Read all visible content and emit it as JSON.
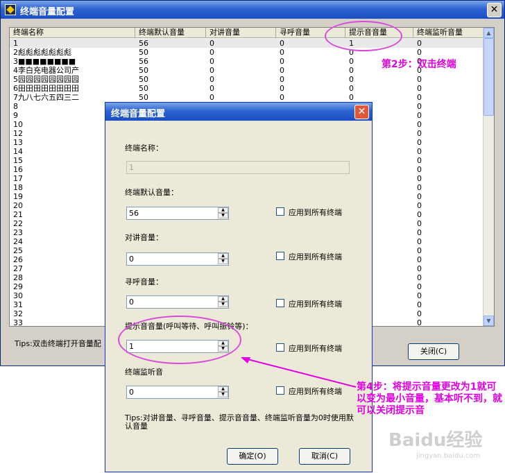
{
  "main": {
    "title": "终端音量配置",
    "columns": [
      "终端名称",
      "终端默认音量",
      "对讲音量",
      "寻呼音量",
      "提示音音量",
      "终端监听音量"
    ],
    "rows": [
      [
        "1",
        "56",
        "0",
        "0",
        "1",
        "0"
      ],
      [
        "2彪彪彪彪彪彪彪",
        "50",
        "0",
        "0",
        "0",
        "0"
      ],
      [
        "3■■■■■■■■",
        "56",
        "0",
        "0",
        "0",
        "0"
      ],
      [
        "4李白充电器公司产",
        "50",
        "0",
        "0",
        "0",
        "0"
      ],
      [
        "5园园园园园园园园",
        "50",
        "0",
        "0",
        "0",
        "0"
      ],
      [
        "6田田田田田田田田",
        "50",
        "0",
        "0",
        "0",
        "0"
      ],
      [
        "7九八七六五四三二",
        "50",
        "0",
        "0",
        "0",
        "0"
      ],
      [
        "8",
        "",
        "",
        "",
        "",
        "0"
      ],
      [
        "9",
        "",
        "",
        "",
        "",
        "0"
      ],
      [
        "10",
        "",
        "",
        "",
        "",
        "0"
      ],
      [
        "12",
        "",
        "",
        "",
        "",
        "0"
      ],
      [
        "13",
        "",
        "",
        "",
        "",
        "0"
      ],
      [
        "14",
        "",
        "",
        "",
        "",
        "0"
      ],
      [
        "15",
        "",
        "",
        "",
        "",
        "0"
      ],
      [
        "16",
        "",
        "",
        "",
        "",
        "0"
      ],
      [
        "17",
        "",
        "",
        "",
        "",
        "0"
      ],
      [
        "18",
        "",
        "",
        "",
        "",
        "0"
      ],
      [
        "19",
        "",
        "",
        "",
        "",
        "0"
      ],
      [
        "20",
        "",
        "",
        "",
        "",
        "0"
      ],
      [
        "21",
        "",
        "",
        "",
        "",
        "0"
      ],
      [
        "22",
        "",
        "",
        "",
        "",
        "0"
      ],
      [
        "23",
        "",
        "",
        "",
        "",
        "0"
      ],
      [
        "24",
        "",
        "",
        "",
        "",
        "0"
      ],
      [
        "25",
        "",
        "",
        "",
        "",
        "0"
      ],
      [
        "26",
        "",
        "",
        "",
        "",
        "0"
      ],
      [
        "27",
        "",
        "",
        "",
        "",
        "0"
      ],
      [
        "28",
        "",
        "",
        "",
        "",
        "0"
      ],
      [
        "29",
        "",
        "",
        "",
        "",
        "0"
      ],
      [
        "30",
        "",
        "",
        "",
        "",
        "0"
      ],
      [
        "31",
        "",
        "",
        "",
        "",
        "0"
      ],
      [
        "32",
        "",
        "",
        "",
        "",
        "0"
      ],
      [
        "33",
        "",
        "",
        "",
        "",
        "0"
      ]
    ],
    "tips": "Tips:双击终端打开音量配",
    "close_label": "关闭(C)"
  },
  "dialog": {
    "title": "终端音量配置",
    "name_label": "终端名称：",
    "name_value": "1",
    "default_label": "终端默认音量：",
    "default_value": "56",
    "talk_label": "对讲音量：",
    "talk_value": "0",
    "page_label": "寻呼音量：",
    "page_value": "0",
    "prompt_label": "提示音音量(呼叫等待、呼叫振铃等)：",
    "prompt_value": "1",
    "monitor_label": "终端监听音",
    "monitor_value": "0",
    "apply_all": "应用到所有终端",
    "tips": "Tips:对讲音量、寻呼音量、提示音音量、终端监听音量为0时使用默认音量",
    "ok_label": "确定(O)",
    "cancel_label": "取消(C)"
  },
  "annotations": {
    "step2": "第2步：双击终端",
    "step4": "第4步：将提示音量更改为1就可以变为最小音量，基本听不到，就可以关闭提示音",
    "color": "#e000e0"
  },
  "watermark": {
    "brand": "Baidu经验",
    "url": "jingyan.baidu.com"
  }
}
